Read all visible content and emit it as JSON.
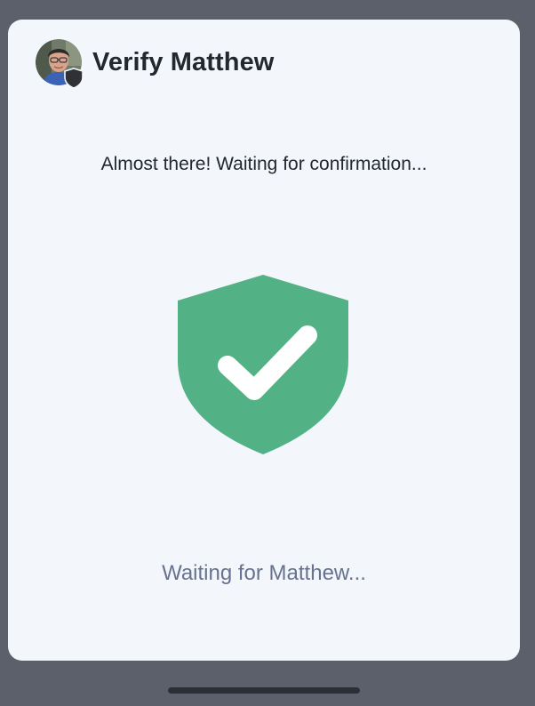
{
  "dialog": {
    "title": "Verify Matthew",
    "avatar_icon": "user-avatar",
    "badge_icon": "shield-badge-icon",
    "status": "Almost there! Waiting for confirmation...",
    "main_icon": "shield-check-icon",
    "waiting": "Waiting for Matthew..."
  },
  "colors": {
    "backdrop": "#5b606b",
    "dialog_bg": "#f3f7fb",
    "shield_green": "#52b286",
    "title_text": "#23272e",
    "waiting_text": "#67728f"
  }
}
